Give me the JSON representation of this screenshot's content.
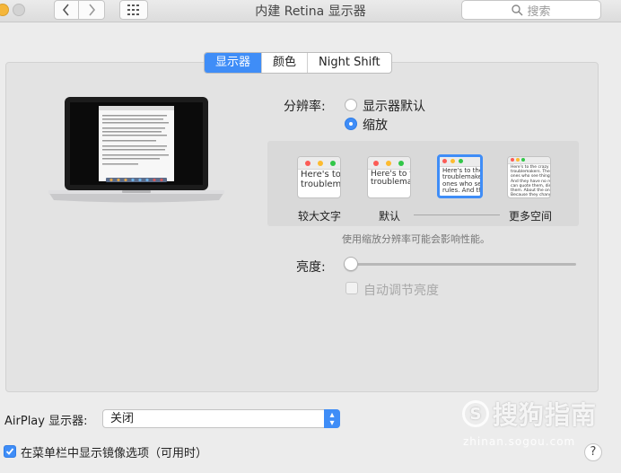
{
  "window": {
    "title": "内建 Retina 显示器",
    "search_placeholder": "搜索"
  },
  "tabs": [
    {
      "label": "显示器",
      "active": true
    },
    {
      "label": "颜色",
      "active": false
    },
    {
      "label": "Night Shift",
      "active": false
    }
  ],
  "resolution": {
    "label": "分辨率:",
    "options": [
      {
        "label": "显示器默认",
        "selected": false
      },
      {
        "label": "缩放",
        "selected": true
      }
    ],
    "scaled": [
      {
        "label": "较大文字",
        "preview": [
          "Here's to",
          "troublem"
        ]
      },
      {
        "label": "默认",
        "preview": [
          "Here's to th",
          "troublemak"
        ]
      },
      {
        "label": "",
        "preview": [
          "Here's to the cr",
          "troublemakers.",
          "ones who see t",
          "rules. And they"
        ]
      },
      {
        "label": "更多空间",
        "preview": [
          "Here's to the crazy one",
          "troublemakers. The roun",
          "ones who see things dif",
          "And they have no respe",
          "can quote them, disagre",
          "them. About the only thi",
          "Because they change th"
        ]
      }
    ],
    "hint": "使用缩放分辨率可能会影响性能。"
  },
  "brightness": {
    "label": "亮度:",
    "value": 0,
    "auto_label": "自动调节亮度",
    "auto_checked": false
  },
  "airplay": {
    "label": "AirPlay 显示器:",
    "value": "关闭"
  },
  "mirror": {
    "label": "在菜单栏中显示镜像选项（可用时）",
    "checked": true
  },
  "help": "?",
  "watermark": {
    "brand": "搜狗指南",
    "logo_letter": "S",
    "url": "zhinan.sogou.com"
  },
  "colors": {
    "accent": "#3f8df7",
    "background": "#ececec",
    "panel": "#e3e3e3"
  }
}
